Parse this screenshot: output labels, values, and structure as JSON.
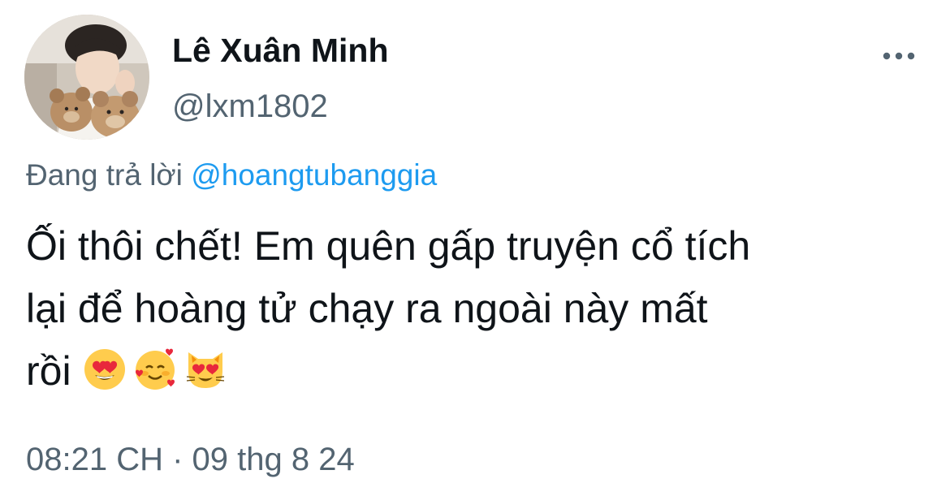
{
  "tweet": {
    "author": {
      "display_name": "Lê Xuân Minh",
      "handle": "@lxm1802"
    },
    "reply": {
      "prefix": "Đang trả lời",
      "mention": "@hoangtubanggia"
    },
    "text_lines": [
      "Ối thôi chết! Em quên gấp truyện cổ tích",
      "lại để hoàng tử chạy ra ngoài này mất",
      "rồi"
    ],
    "emojis": [
      "smiling-face-with-heart-eyes",
      "smiling-face-with-hearts",
      "smiling-cat-with-heart-eyes"
    ],
    "timestamp": "08:21 CH · 09 thg 8 24"
  },
  "colors": {
    "text_primary": "#0f1419",
    "text_secondary": "#536471",
    "link": "#1d9bf0"
  }
}
